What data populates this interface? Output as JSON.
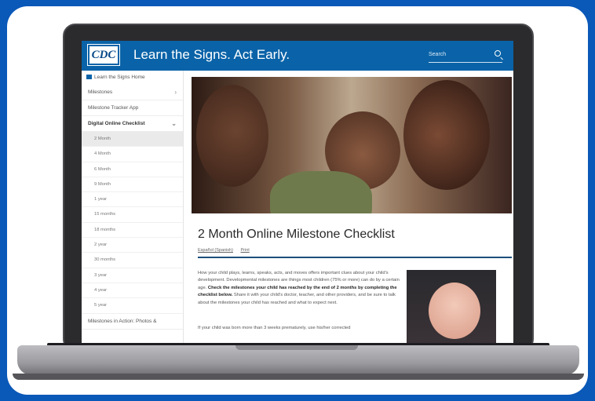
{
  "header": {
    "logo_text": "CDC",
    "site_title": "Learn the Signs. Act Early.",
    "search_placeholder": "Search"
  },
  "sidebar": {
    "home_label": "Learn the Signs Home",
    "items": [
      {
        "label": "Milestones",
        "chevron": "›"
      },
      {
        "label": "Milestone Tracker App"
      },
      {
        "label": "Digital Online Checklist",
        "chevron": "⌄"
      }
    ],
    "sub_items": [
      "2 Month",
      "4 Month",
      "6 Month",
      "9 Month",
      "1 year",
      "15 months",
      "18 months",
      "2 year",
      "30 months",
      "3 year",
      "4 year",
      "5 year"
    ],
    "footer_item": "Milestones in Action: Photos &"
  },
  "main": {
    "title": "2 Month Online Milestone Checklist",
    "links": [
      "Español (Spanish)",
      "Print"
    ],
    "paragraph1": "How your child plays, learns, speaks, acts, and moves offers important clues about your child's development. Developmental milestones are things most children (75% or more) can do by a certain age.",
    "paragraph1_bold": "Check the milestones your child has reached by the end of 2 months by completing the checklist below.",
    "paragraph1_end": "Share it with your child's doctor, teacher, and other providers, and be sure to talk about the milestones your child has reached and what to expect next.",
    "paragraph2": "If your child was born more than 3 weeks prematurely, use his/her corrected"
  },
  "colors": {
    "brand_blue": "#0a63a8",
    "frame_blue": "#0a58b8"
  }
}
